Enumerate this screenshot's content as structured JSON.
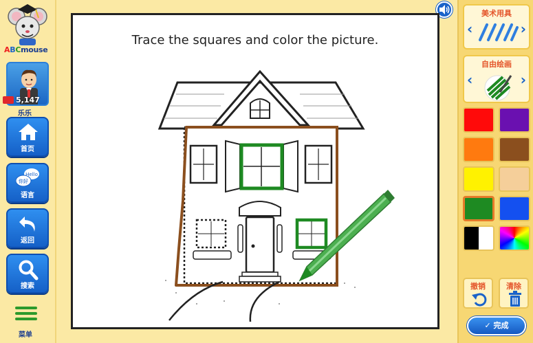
{
  "brand": {
    "logo_text": "ABCmouse"
  },
  "user": {
    "tickets": "5,147",
    "name": "乐乐"
  },
  "nav": {
    "home_label": "首页",
    "language_label": "语言",
    "language_bubble_en": "Hello",
    "language_bubble_cn": "你好",
    "back_label": "返回",
    "search_label": "搜索",
    "menu_label": "菜单"
  },
  "activity": {
    "instruction": "Trace the squares and color the picture."
  },
  "tools": {
    "art_supplies_title": "美术用具",
    "free_draw_title": "自由绘画",
    "prev_arrow": "‹",
    "next_arrow": "›"
  },
  "palette": [
    {
      "name": "red",
      "color": "#ff0a0a"
    },
    {
      "name": "purple",
      "color": "#6a10b0"
    },
    {
      "name": "orange",
      "color": "#ff7a0f"
    },
    {
      "name": "brown",
      "color": "#8b4f1e"
    },
    {
      "name": "yellow",
      "color": "#fff200"
    },
    {
      "name": "peach",
      "color": "#f5cf9a"
    },
    {
      "name": "green",
      "color": "#1e8a22",
      "selected": true
    },
    {
      "name": "blue",
      "color": "#1450f0"
    },
    {
      "name": "black-white",
      "color": "#000000"
    },
    {
      "name": "rainbow",
      "color": "#ff00ff"
    }
  ],
  "actions": {
    "undo_label": "撤销",
    "clear_label": "清除",
    "done_label": "完成",
    "done_check": "✓"
  },
  "colors": {
    "accent_blue": "#1a63c9",
    "trace_green": "#1e8a22",
    "trace_brown": "#8b4f1e"
  }
}
